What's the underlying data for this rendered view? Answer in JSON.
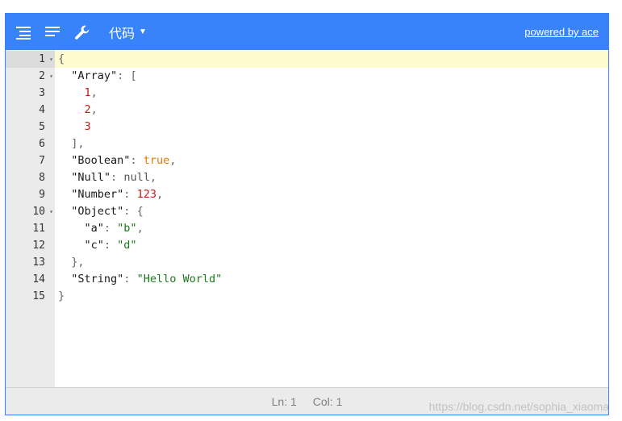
{
  "menu": {
    "buttons": [
      {
        "name": "format-icon"
      },
      {
        "name": "compact-icon"
      },
      {
        "name": "repair-icon"
      }
    ],
    "mode_label": "代码",
    "powered_label": "powered by ace"
  },
  "gutter": {
    "lines": [
      "1",
      "2",
      "3",
      "4",
      "5",
      "6",
      "7",
      "8",
      "9",
      "10",
      "11",
      "12",
      "13",
      "14",
      "15"
    ],
    "fold_marker": "▾"
  },
  "code": [
    [
      {
        "t": "bracket",
        "v": "{"
      }
    ],
    [
      {
        "t": "sp",
        "v": "  "
      },
      {
        "t": "key",
        "v": "\"Array\""
      },
      {
        "t": "punc",
        "v": ": "
      },
      {
        "t": "bracket",
        "v": "["
      }
    ],
    [
      {
        "t": "sp",
        "v": "    "
      },
      {
        "t": "num",
        "v": "1"
      },
      {
        "t": "punc",
        "v": ","
      }
    ],
    [
      {
        "t": "sp",
        "v": "    "
      },
      {
        "t": "num",
        "v": "2"
      },
      {
        "t": "punc",
        "v": ","
      }
    ],
    [
      {
        "t": "sp",
        "v": "    "
      },
      {
        "t": "num",
        "v": "3"
      }
    ],
    [
      {
        "t": "sp",
        "v": "  "
      },
      {
        "t": "bracket",
        "v": "]"
      },
      {
        "t": "punc",
        "v": ","
      }
    ],
    [
      {
        "t": "sp",
        "v": "  "
      },
      {
        "t": "key",
        "v": "\"Boolean\""
      },
      {
        "t": "punc",
        "v": ": "
      },
      {
        "t": "bool",
        "v": "true"
      },
      {
        "t": "punc",
        "v": ","
      }
    ],
    [
      {
        "t": "sp",
        "v": "  "
      },
      {
        "t": "key",
        "v": "\"Null\""
      },
      {
        "t": "punc",
        "v": ": "
      },
      {
        "t": "null",
        "v": "null"
      },
      {
        "t": "punc",
        "v": ","
      }
    ],
    [
      {
        "t": "sp",
        "v": "  "
      },
      {
        "t": "key",
        "v": "\"Number\""
      },
      {
        "t": "punc",
        "v": ": "
      },
      {
        "t": "num",
        "v": "123"
      },
      {
        "t": "punc",
        "v": ","
      }
    ],
    [
      {
        "t": "sp",
        "v": "  "
      },
      {
        "t": "key",
        "v": "\"Object\""
      },
      {
        "t": "punc",
        "v": ": "
      },
      {
        "t": "bracket",
        "v": "{"
      }
    ],
    [
      {
        "t": "sp",
        "v": "    "
      },
      {
        "t": "key",
        "v": "\"a\""
      },
      {
        "t": "punc",
        "v": ": "
      },
      {
        "t": "str",
        "v": "\"b\""
      },
      {
        "t": "punc",
        "v": ","
      }
    ],
    [
      {
        "t": "sp",
        "v": "    "
      },
      {
        "t": "key",
        "v": "\"c\""
      },
      {
        "t": "punc",
        "v": ": "
      },
      {
        "t": "str",
        "v": "\"d\""
      }
    ],
    [
      {
        "t": "sp",
        "v": "  "
      },
      {
        "t": "bracket",
        "v": "}"
      },
      {
        "t": "punc",
        "v": ","
      }
    ],
    [
      {
        "t": "sp",
        "v": "  "
      },
      {
        "t": "key",
        "v": "\"String\""
      },
      {
        "t": "punc",
        "v": ": "
      },
      {
        "t": "str",
        "v": "\"Hello World\""
      }
    ],
    [
      {
        "t": "bracket",
        "v": "}"
      }
    ]
  ],
  "status": {
    "ln": "Ln: 1",
    "col": "Col: 1"
  },
  "watermark": "https://blog.csdn.net/sophia_xiaoma",
  "colors": {
    "accent": "#3883fa",
    "active_line": "#fffbd1"
  }
}
